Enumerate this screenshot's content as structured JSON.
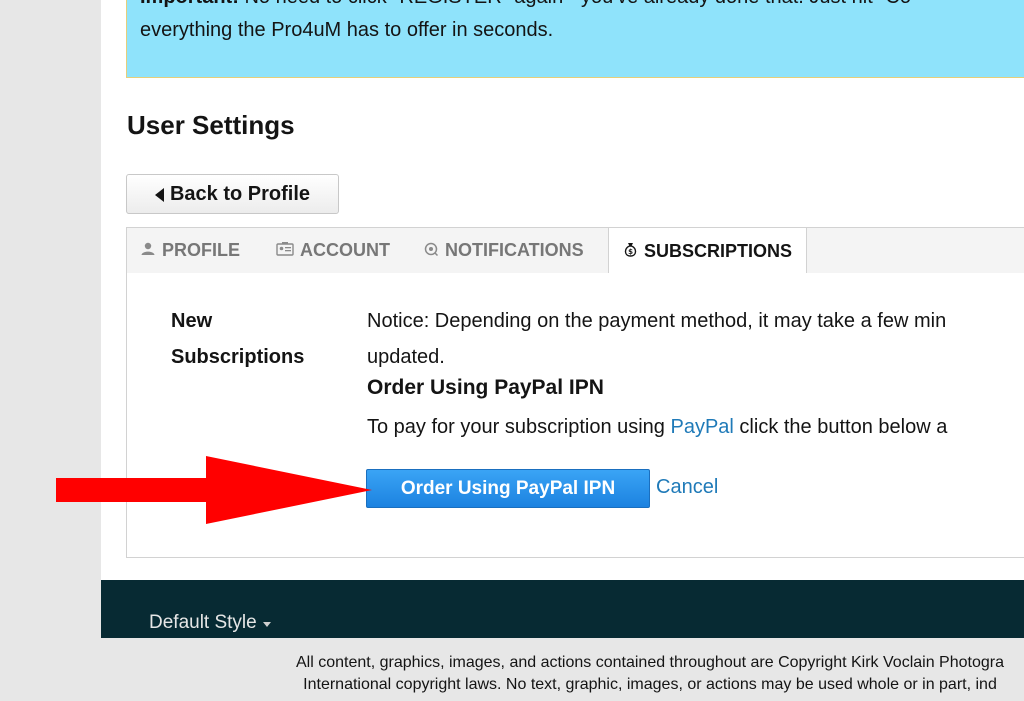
{
  "notice": {
    "line1_bold": "Important:",
    "line1_rest": " No need to click \"REGISTER\" again - you've already done that. Just hit \"Co",
    "line2": "everything the Pro4uM has to offer in seconds."
  },
  "page_title": "User Settings",
  "back_button": {
    "label": "Back to Profile",
    "icon": "caret-left-icon"
  },
  "tabs": [
    {
      "label": "PROFILE",
      "icon": "user-icon",
      "active": false
    },
    {
      "label": "ACCOUNT",
      "icon": "id-card-icon",
      "active": false
    },
    {
      "label": "NOTIFICATIONS",
      "icon": "bell-icon",
      "active": false
    },
    {
      "label": "SUBSCRIPTIONS",
      "icon": "money-bag-icon",
      "active": true
    }
  ],
  "subscriptions": {
    "section_label": "New Subscriptions",
    "notice_text": "Notice: Depending on the payment method, it may take a few min",
    "notice_text_line2": "updated.",
    "order_heading": "Order Using PayPal IPN",
    "instruction_before": "To pay for your subscription using ",
    "instruction_link": "PayPal",
    "instruction_after": " click the button below a",
    "order_button": "Order Using PayPal IPN",
    "cancel": "Cancel"
  },
  "footer": {
    "style_chooser": "Default Style",
    "copyright_line1": "All content, graphics, images, and actions contained throughout are Copyright Kirk Voclain Photogra",
    "copyright_line2": "International copyright laws. No text, graphic, images, or actions may be used whole or in part, ind"
  },
  "colors": {
    "notice_bg": "#8fe3fb",
    "button_blue": "#1c82e0",
    "link_blue": "#1f7ab8",
    "footer_bg": "#072a33",
    "annotation_arrow": "#ff0000"
  }
}
